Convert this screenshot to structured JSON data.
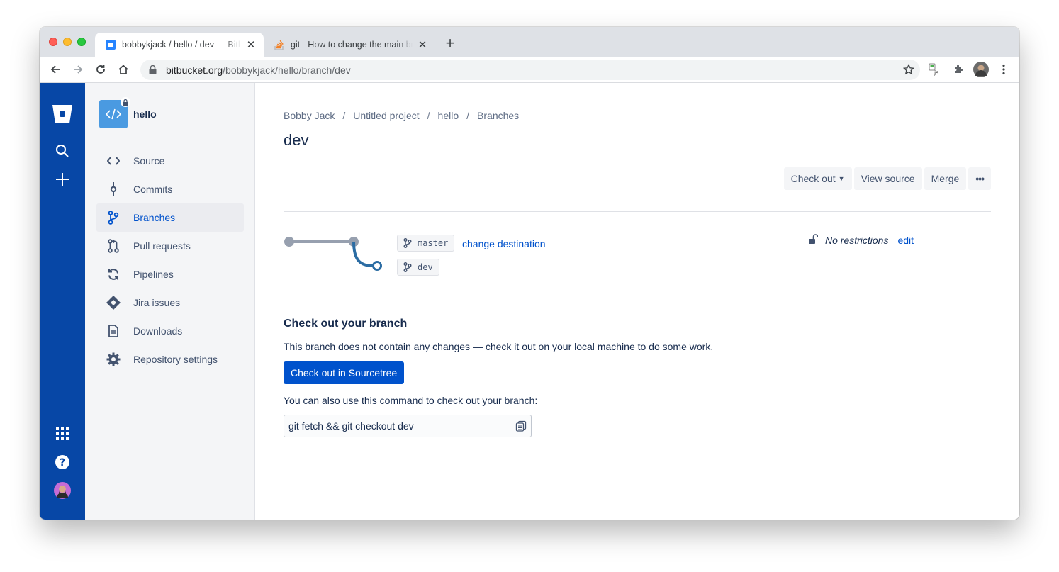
{
  "browser": {
    "tabs": [
      {
        "title": "bobbykjack / hello / dev — Bitbucket",
        "active": true
      },
      {
        "title": "git - How to change the main branch",
        "active": false
      }
    ],
    "url_host": "bitbucket.org",
    "url_path": "/bobbykjack/hello/branch/dev",
    "new_tab_label": "+"
  },
  "globalnav": {
    "icons": [
      "bitbucket-logo-icon",
      "search-icon",
      "create-icon",
      "app-switcher-icon",
      "help-icon",
      "profile-avatar"
    ]
  },
  "sidebar": {
    "repo_name": "hello",
    "items": [
      {
        "label": "Source",
        "icon": "source-icon",
        "active": false
      },
      {
        "label": "Commits",
        "icon": "commits-icon",
        "active": false
      },
      {
        "label": "Branches",
        "icon": "branches-icon",
        "active": true
      },
      {
        "label": "Pull requests",
        "icon": "pull-requests-icon",
        "active": false
      },
      {
        "label": "Pipelines",
        "icon": "pipelines-icon",
        "active": false
      },
      {
        "label": "Jira issues",
        "icon": "jira-icon",
        "active": false
      },
      {
        "label": "Downloads",
        "icon": "downloads-icon",
        "active": false
      },
      {
        "label": "Repository settings",
        "icon": "settings-icon",
        "active": false
      }
    ]
  },
  "main": {
    "breadcrumb": [
      "Bobby Jack",
      "Untitled project",
      "hello",
      "Branches"
    ],
    "breadcrumb_sep": "/",
    "title": "dev",
    "actions": {
      "checkout": "Check out",
      "view_source": "View source",
      "merge": "Merge",
      "more": "•••"
    },
    "graph": {
      "destination_branch": "master",
      "change_destination": "change destination",
      "source_branch": "dev"
    },
    "restrictions": {
      "text": "No restrictions",
      "edit": "edit"
    },
    "checkout_section": {
      "title": "Check out your branch",
      "description": "This branch does not contain any changes — check it out on your local machine to do some work.",
      "button": "Check out in Sourcetree",
      "command_label": "You can also use this command to check out your branch:",
      "command": "git fetch && git checkout dev"
    }
  },
  "colors": {
    "global_nav": "#0747a6",
    "primary": "#0052cc",
    "sidebar_bg": "#f4f5f7",
    "graph_grey": "#97a0af",
    "graph_blue": "#2b6ca3"
  }
}
